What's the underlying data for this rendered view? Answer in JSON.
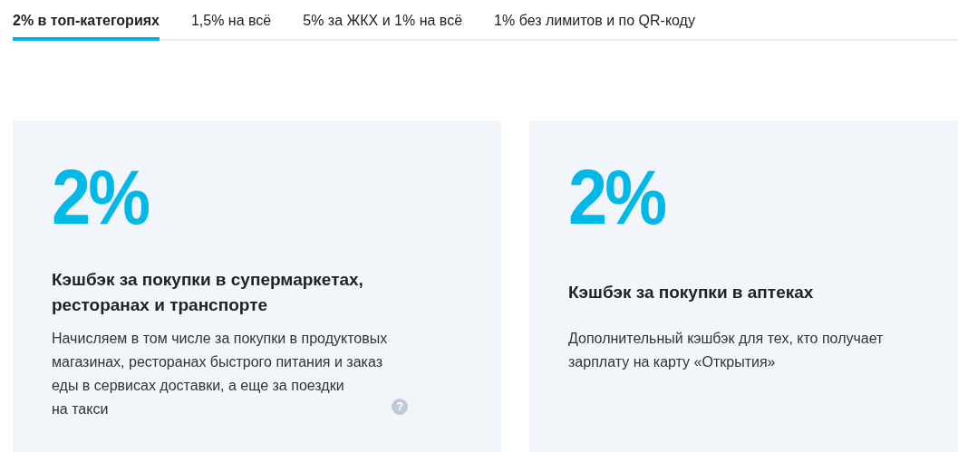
{
  "tabs": [
    {
      "label": "2% в топ-категориях",
      "selected": true
    },
    {
      "label": "1,5% на всё",
      "selected": false
    },
    {
      "label": "5% за ЖКХ и 1% на всё",
      "selected": false
    },
    {
      "label": "1% без лимитов и по QR-коду",
      "selected": false
    }
  ],
  "cards": [
    {
      "rate": "2%",
      "title": "Кэшбэк за покупки в супермаркетах,\nресторанах и транспорте",
      "description": "Начисляем в том числе за покупки в продуктовых\nмагазинах, ресторанах быстрого питания и заказ\nеды в сервисах доставки, а еще за поездки\nна такси",
      "help_icon": "?"
    },
    {
      "rate": "2%",
      "title": "Кэшбэк за покупки в аптеках",
      "description": "Дополнительный кэшбэк для тех, кто получает\nзарплату на карту «Открытия»"
    }
  ]
}
